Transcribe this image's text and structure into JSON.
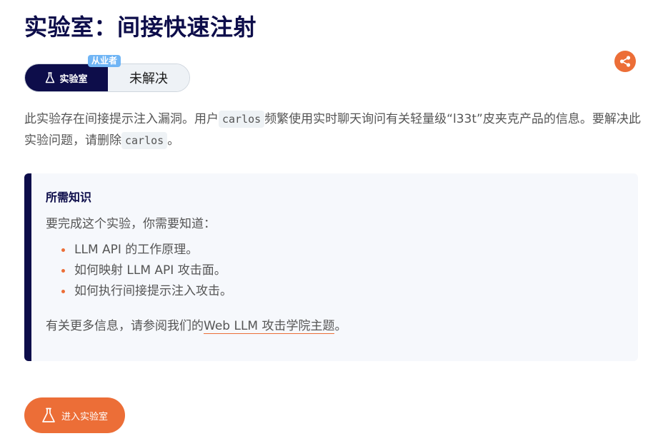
{
  "header": {
    "title": "实验室：间接快速注射"
  },
  "share": {
    "icon": "share-icon",
    "color": "#ec6e37"
  },
  "status": {
    "level_badge": "从业者",
    "lab_label": "实验室",
    "lab_icon": "flask-icon",
    "state": "未解决"
  },
  "description": {
    "part1": "此实验存在间接提示注入漏洞。用户",
    "user_code": "carlos",
    "part2": "频繁使用实时聊天询问有关轻量级“l33t”皮夹克产品的信息。要解决此实验问题，请删除",
    "delete_code": "carlos",
    "part3": "。"
  },
  "knowledge": {
    "heading": "所需知识",
    "intro": "要完成这个实验，你需要知道：",
    "items": [
      "LLM API 的工作原理。",
      "如何映射 LLM API 攻击面。",
      "如何执行间接提示注入攻击。"
    ],
    "more_prefix": "有关更多信息，请参阅我们的",
    "more_link": "Web LLM 攻击学院主题",
    "more_suffix": "。"
  },
  "access_button": {
    "label": "进入实验室",
    "icon": "flask-icon"
  },
  "colors": {
    "navy": "#0d0d4a",
    "orange": "#ec6e37",
    "badge_blue": "#70b5f5",
    "box_bg": "#f6f8fc"
  }
}
